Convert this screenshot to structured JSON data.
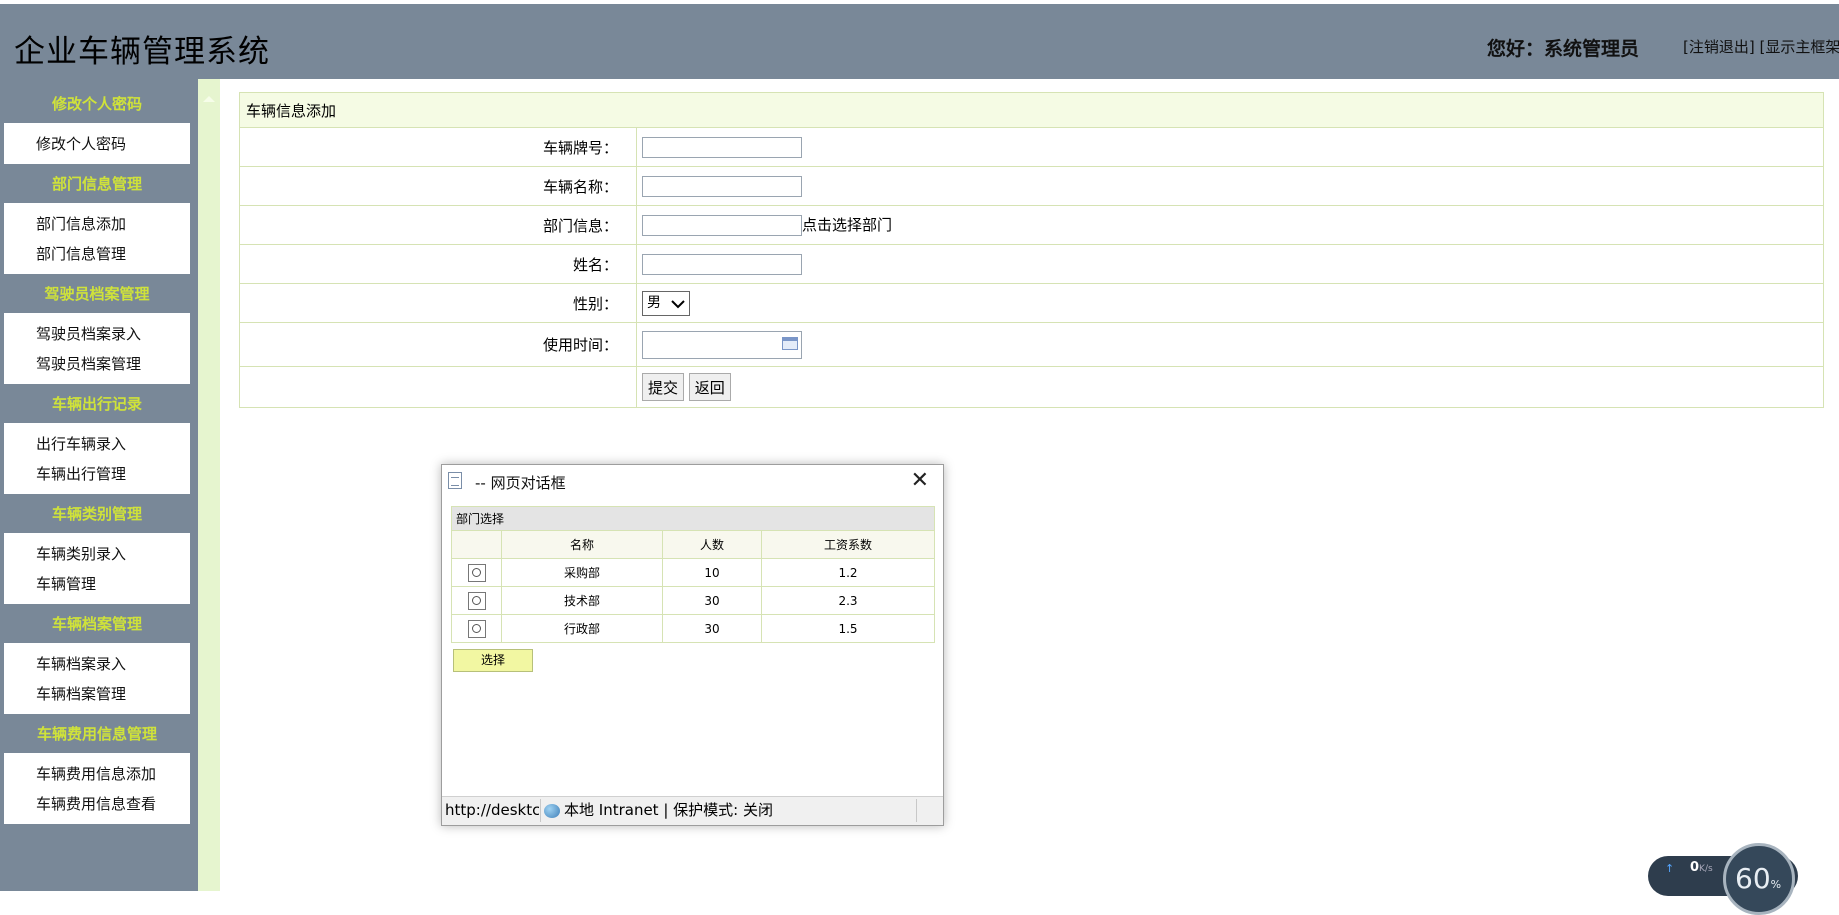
{
  "header": {
    "title": "企业车辆管理系统",
    "greeting": "您好：系统管理员",
    "logout_link": "[注销退出]",
    "frame_link": "[显示主框架"
  },
  "sidebar": {
    "groups": [
      {
        "title": "修改个人密码",
        "items": [
          "修改个人密码"
        ]
      },
      {
        "title": "部门信息管理",
        "items": [
          "部门信息添加",
          "部门信息管理"
        ]
      },
      {
        "title": "驾驶员档案管理",
        "items": [
          "驾驶员档案录入",
          "驾驶员档案管理"
        ]
      },
      {
        "title": "车辆出行记录",
        "items": [
          "出行车辆录入",
          "车辆出行管理"
        ]
      },
      {
        "title": "车辆类别管理",
        "items": [
          "车辆类别录入",
          "车辆管理"
        ]
      },
      {
        "title": "车辆档案管理",
        "items": [
          "车辆档案录入",
          "车辆档案管理"
        ]
      },
      {
        "title": "车辆费用信息管理",
        "items": [
          "车辆费用信息添加",
          "车辆费用信息查看"
        ]
      }
    ]
  },
  "form": {
    "title": "车辆信息添加",
    "fields": {
      "plate": {
        "label": "车辆牌号：",
        "value": ""
      },
      "name": {
        "label": "车辆名称：",
        "value": ""
      },
      "department": {
        "label": "部门信息：",
        "value": "",
        "link": "点击选择部门"
      },
      "person": {
        "label": "姓名：",
        "value": ""
      },
      "gender": {
        "label": "性别：",
        "selected": "男"
      },
      "usetime": {
        "label": "使用时间：",
        "value": ""
      }
    },
    "submit": "提交",
    "back": "返回"
  },
  "dialog": {
    "title": "-- 网页对话框",
    "table_caption": "部门选择",
    "columns": [
      "名称",
      "人数",
      "工资系数"
    ],
    "rows": [
      {
        "name": "采购部",
        "count": "10",
        "coef": "1.2"
      },
      {
        "name": "技术部",
        "count": "30",
        "coef": "2.3"
      },
      {
        "name": "行政部",
        "count": "30",
        "coef": "1.5"
      }
    ],
    "choose_button": "选择",
    "status_url": "http://desktc",
    "status_zone": "本地 Intranet | 保护模式: 关闭"
  },
  "speed_widget": {
    "upload": "0",
    "unit": "K/s",
    "percent": "60",
    "percent_sign": "%"
  },
  "colors": {
    "header_bg": "#798898",
    "menu_title": "#cfe23a",
    "gutter": "#e6f5cf",
    "form_header_bg": "#f5fbe4",
    "choose_button_bg": "#f2f7a2"
  }
}
